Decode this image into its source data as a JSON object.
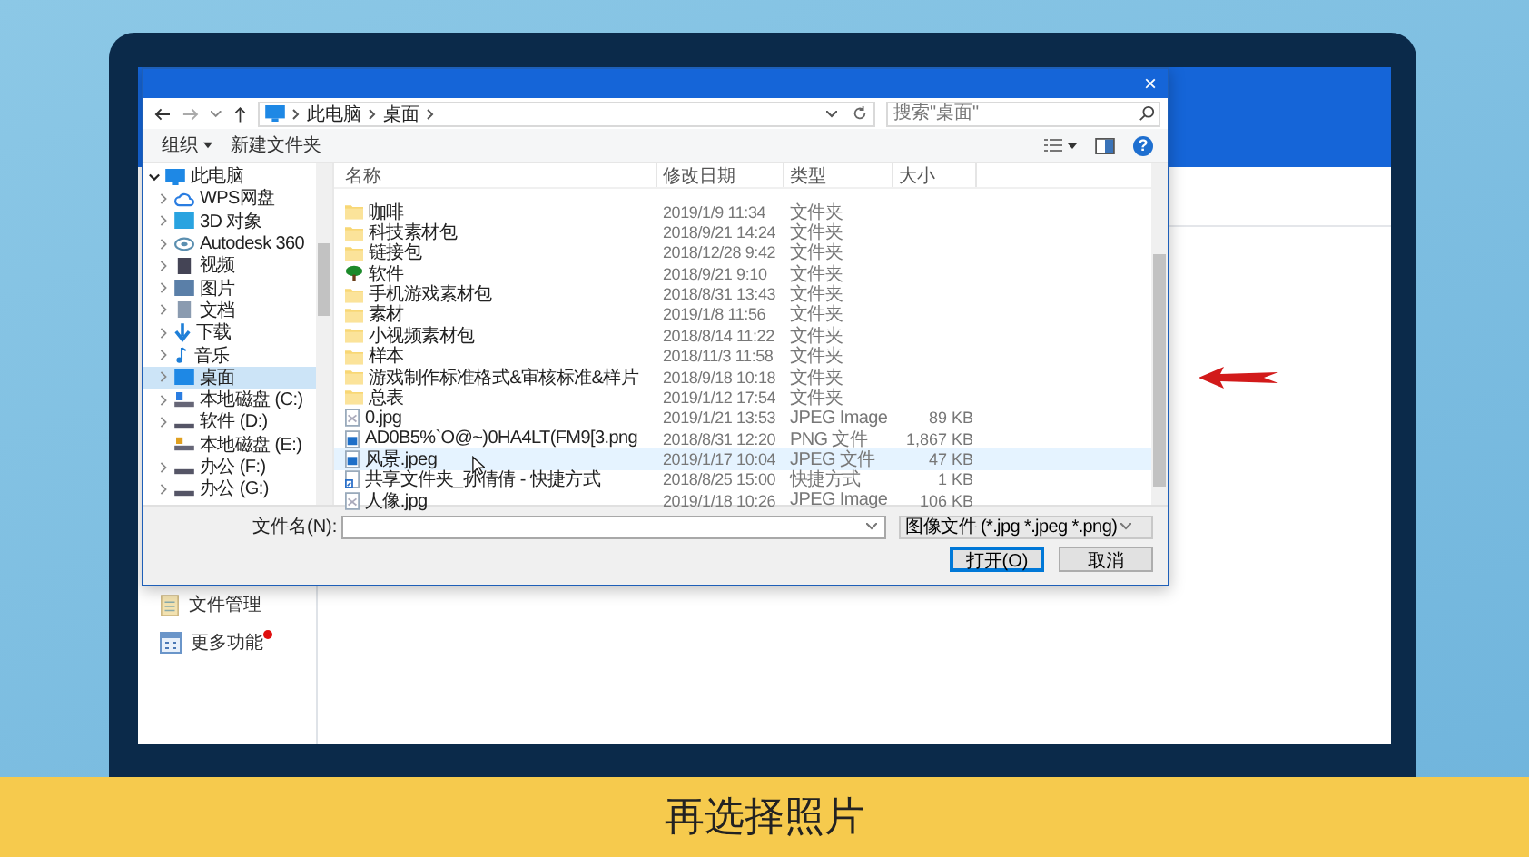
{
  "dialog": {
    "close": "×",
    "address": {
      "path": [
        "此电脑",
        "桌面"
      ],
      "search_placeholder": "搜索\"桌面\""
    },
    "toolbar": {
      "organize": "组织",
      "new_folder": "新建文件夹",
      "help": "?"
    },
    "nav": [
      {
        "label": "此电脑",
        "kind": "computer",
        "expandable": true,
        "expanded": true,
        "selected": false,
        "children": [
          {
            "label": "WPS网盘",
            "kind": "cloud",
            "expandable": true,
            "expanded": false,
            "selected": false
          },
          {
            "label": "3D 对象",
            "kind": "cube",
            "expandable": true,
            "expanded": false,
            "selected": false
          },
          {
            "label": "Autodesk 360",
            "kind": "disc",
            "expandable": true,
            "expanded": false,
            "selected": false
          },
          {
            "label": "视频",
            "kind": "video",
            "expandable": true,
            "expanded": false,
            "selected": false
          },
          {
            "label": "图片",
            "kind": "picture",
            "expandable": true,
            "expanded": false,
            "selected": false
          },
          {
            "label": "文档",
            "kind": "document",
            "expandable": true,
            "expanded": false,
            "selected": false
          },
          {
            "label": "下载",
            "kind": "download",
            "expandable": true,
            "expanded": false,
            "selected": false
          },
          {
            "label": "音乐",
            "kind": "music",
            "expandable": true,
            "expanded": false,
            "selected": false
          },
          {
            "label": "桌面",
            "kind": "desktop",
            "expandable": true,
            "expanded": false,
            "selected": true
          },
          {
            "label": "本地磁盘 (C:)",
            "kind": "system-drive",
            "expandable": true,
            "expanded": false,
            "selected": false
          },
          {
            "label": "软件 (D:)",
            "kind": "drive",
            "expandable": true,
            "expanded": false,
            "selected": false
          },
          {
            "label": "本地磁盘 (E:)",
            "kind": "locked-drive",
            "expandable": false,
            "selected": false
          },
          {
            "label": "办公 (F:)",
            "kind": "drive",
            "expandable": true,
            "expanded": false,
            "selected": false
          },
          {
            "label": "办公 (G:)",
            "kind": "drive",
            "expandable": true,
            "expanded": false,
            "selected": false
          }
        ]
      }
    ],
    "columns": [
      "名称",
      "修改日期",
      "类型",
      "大小"
    ],
    "files": [
      {
        "name": "咖啡",
        "date": "2019/1/9 11:34",
        "type": "文件夹",
        "kind": "folder",
        "selected": false
      },
      {
        "name": "科技素材包",
        "date": "2018/9/21 14:24",
        "type": "文件夹",
        "kind": "folder",
        "selected": false
      },
      {
        "name": "链接包",
        "date": "2018/12/28 9:42",
        "type": "文件夹",
        "kind": "folder",
        "selected": false
      },
      {
        "name": "软件",
        "date": "2018/9/21 9:10",
        "type": "文件夹",
        "kind": "tree",
        "selected": false
      },
      {
        "name": "手机游戏素材包",
        "date": "2018/8/31 13:43",
        "type": "文件夹",
        "kind": "folder",
        "selected": false
      },
      {
        "name": "素材",
        "date": "2019/1/8 11:56",
        "type": "文件夹",
        "kind": "folder",
        "selected": false
      },
      {
        "name": "小视频素材包",
        "date": "2018/8/14 11:22",
        "type": "文件夹",
        "kind": "folder",
        "selected": false
      },
      {
        "name": "样本",
        "date": "2018/11/3 11:58",
        "type": "文件夹",
        "kind": "folder",
        "selected": false
      },
      {
        "name": "游戏制作标准格式&审核标准&样片",
        "date": "2018/9/18 10:18",
        "type": "文件夹",
        "kind": "folder",
        "selected": false
      },
      {
        "name": "总表",
        "date": "2019/1/12 17:54",
        "type": "文件夹",
        "kind": "folder",
        "selected": false
      },
      {
        "name": "0.jpg",
        "date": "2019/1/21 13:53",
        "type": "JPEG Image",
        "size": "89 KB",
        "kind": "file",
        "selected": false
      },
      {
        "name": "AD0B5%`O@~)0HA4LT(FM9[3.png",
        "date": "2018/8/31 12:20",
        "type": "PNG 文件",
        "size": "1,867 KB",
        "kind": "image",
        "selected": false
      },
      {
        "name": "风景.jpeg",
        "date": "2019/1/17 10:04",
        "type": "JPEG 文件",
        "size": "47 KB",
        "kind": "image",
        "selected": true
      },
      {
        "name": "共享文件夹_孙倩倩 - 快捷方式",
        "date": "2018/8/25 15:00",
        "type": "快捷方式",
        "size": "1 KB",
        "kind": "shortcut",
        "selected": false
      },
      {
        "name": "人像.jpg",
        "date": "2019/1/18 10:26",
        "type": "JPEG Image",
        "size": "106 KB",
        "kind": "file",
        "selected": false
      }
    ],
    "filename_label": "文件名(N):",
    "filter": "图像文件 (*.jpg *.jpeg *.png)",
    "buttons": [
      {
        "label": "打开(O)",
        "kind": "primary"
      },
      {
        "label": "取消",
        "kind": "normal"
      }
    ]
  },
  "app": {
    "sidebar": [
      {
        "label": "文件管理",
        "kind": "file",
        "badge": false
      },
      {
        "label": "更多功能",
        "kind": "grid",
        "badge": true
      }
    ]
  },
  "caption": "再选择照片"
}
